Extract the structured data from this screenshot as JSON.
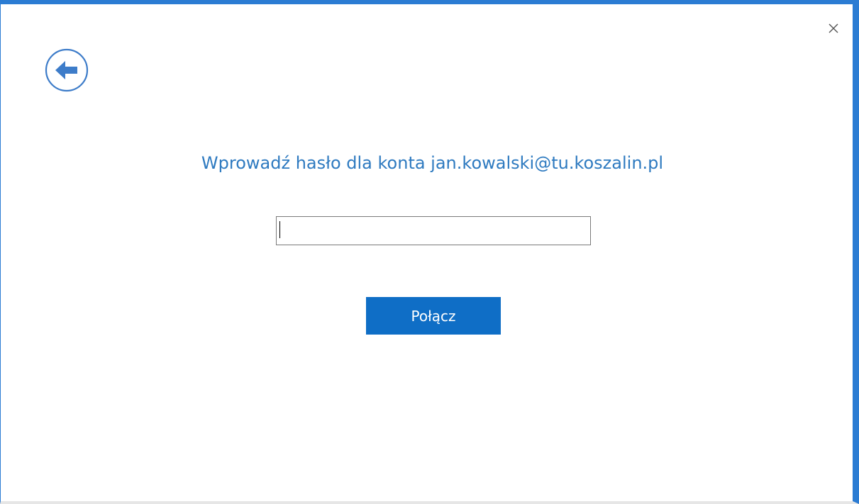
{
  "dialog": {
    "prompt": "Wprowadź hasło dla konta jan.kowalski@tu.koszalin.pl",
    "password_value": "",
    "password_placeholder": "",
    "connect_label": "Połącz"
  },
  "icons": {
    "back": "back-arrow-icon",
    "close": "close-icon"
  },
  "colors": {
    "accent": "#2b7cd3",
    "title": "#2e7ac0",
    "button": "#0f6ec6",
    "back_icon": "#3d7cc9"
  }
}
